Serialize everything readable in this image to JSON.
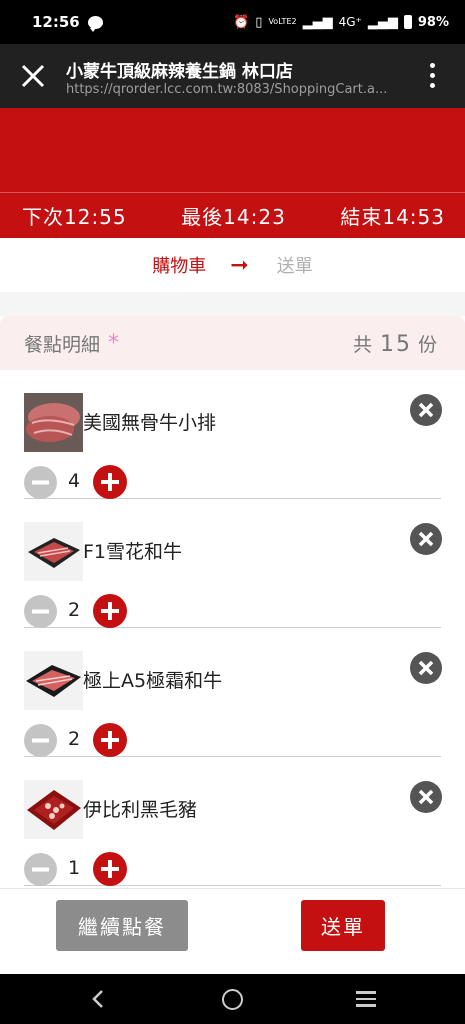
{
  "status_bar": {
    "time": "12:56",
    "network": "4G⁺",
    "volte": "VoLTE2",
    "battery": "98%",
    "icons": [
      "chat-bubble-icon",
      "alarm-icon",
      "vibrate-icon",
      "signal-icon",
      "battery-icon"
    ]
  },
  "browser": {
    "title": "小蒙牛頂級麻辣養生鍋 林口店",
    "url": "https://qrorder.lcc.com.tw:8083/ShoppingCart.a..."
  },
  "times": {
    "next": "下次12:55",
    "last": "最後14:23",
    "end": "結束14:53"
  },
  "steps": {
    "cart": "購物車",
    "arrow": "➞",
    "submit": "送單"
  },
  "summary": {
    "label": "餐點明細",
    "star": "*",
    "total_prefix": "共",
    "total_count": "15",
    "total_suffix": "份"
  },
  "items": [
    {
      "name": "美國無骨牛小排",
      "qty": "4"
    },
    {
      "name": "F1雪花和牛",
      "qty": "2"
    },
    {
      "name": "極上A5極霜和牛",
      "qty": "2"
    },
    {
      "name": "伊比利黑毛豬",
      "qty": "1"
    }
  ],
  "footer": {
    "continue_label": "繼續點餐",
    "submit_label": "送單"
  },
  "colors": {
    "brand_red": "#c41010",
    "grey_button": "#8c8c8c",
    "summary_bg": "#fbeeee"
  }
}
